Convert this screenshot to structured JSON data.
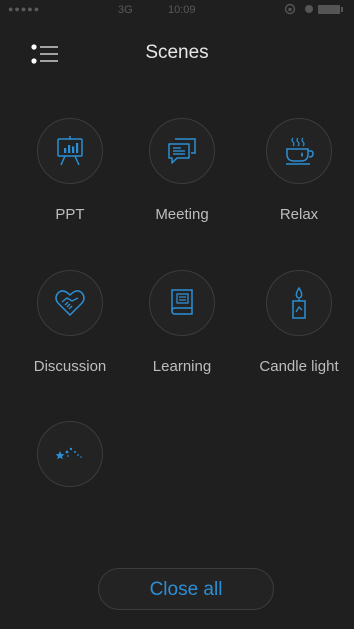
{
  "status": {
    "signal_dots": "●●●●●",
    "carrier": "3G",
    "time": "10:09"
  },
  "header": {
    "title": "Scenes"
  },
  "scenes": [
    {
      "label": "PPT",
      "icon": "presentation-board-icon"
    },
    {
      "label": "Meeting",
      "icon": "chat-bubbles-icon"
    },
    {
      "label": "Relax",
      "icon": "coffee-cup-icon"
    },
    {
      "label": "Discussion",
      "icon": "handshake-heart-icon"
    },
    {
      "label": "Learning",
      "icon": "book-icon"
    },
    {
      "label": "Candle light",
      "icon": "candle-icon"
    },
    {
      "label": "",
      "icon": "stars-icon"
    }
  ],
  "footer": {
    "close_all": "Close all"
  },
  "colors": {
    "accent": "#2b8fd6",
    "background": "#1f1f1f",
    "circle_border": "#3c3c3c"
  }
}
